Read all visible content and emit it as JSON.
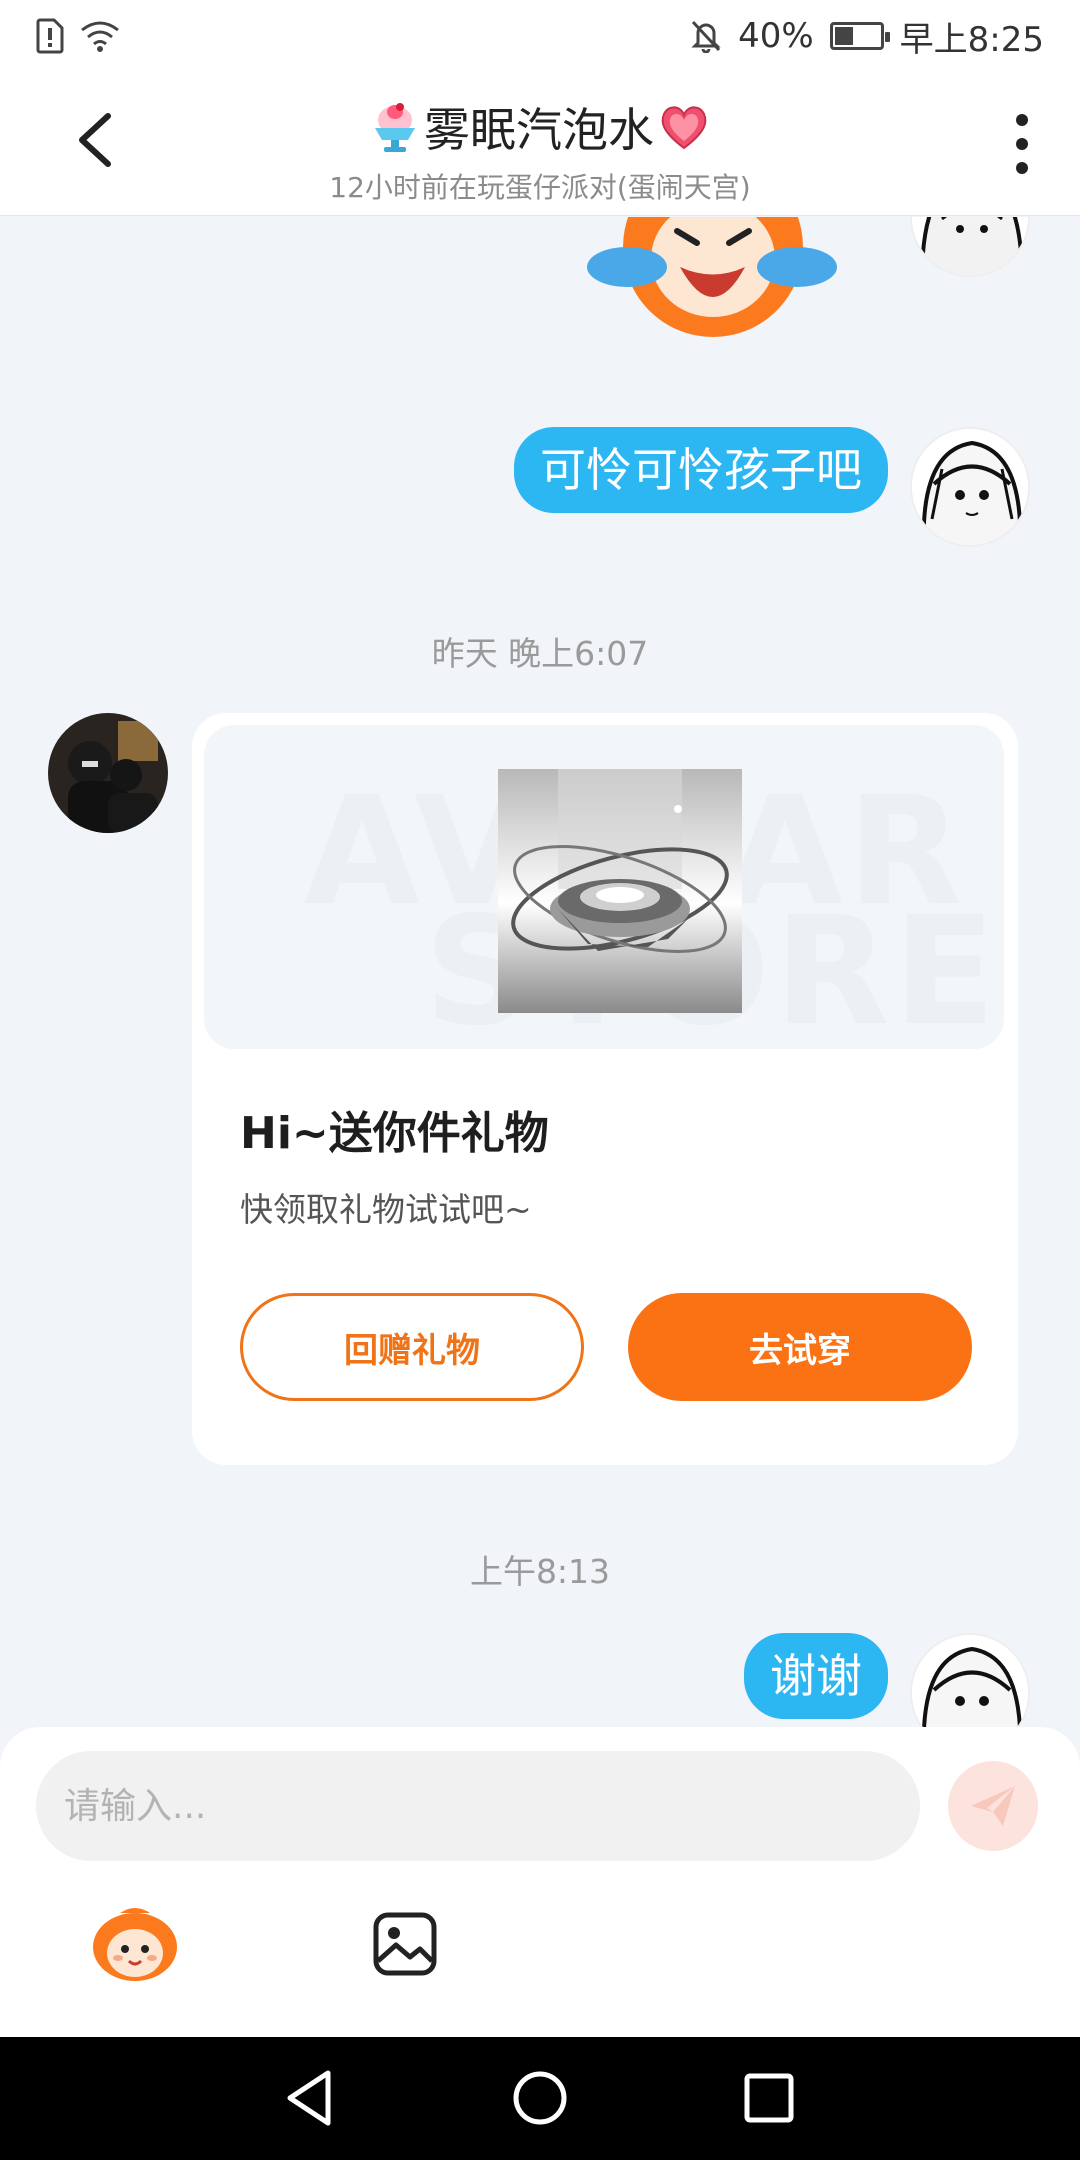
{
  "status": {
    "battery": "40%",
    "time": "早上8:25",
    "battery_level": 0.4
  },
  "header": {
    "title": "雾眠汽泡水",
    "subtitle": "12小时前在玩蛋仔派对(蛋闹天宫)"
  },
  "messages": {
    "m1": "可怜可怜孩子吧",
    "ts1": "昨天 晚上6:07",
    "card": {
      "watermark_line1": "AVATAR",
      "watermark_line2": "STORE",
      "title": "Hi~送你件礼物",
      "desc": "快领取礼物试试吧~",
      "btn_return": "回赠礼物",
      "btn_try": "去试穿"
    },
    "ts2": "上午8:13",
    "m2": "谢谢"
  },
  "input": {
    "placeholder": "请输入..."
  },
  "colors": {
    "accent": "#fb7214",
    "bubble": "#2cb6f2",
    "bg": "#f1f4f8"
  },
  "icons": [
    "back-icon",
    "more-icon",
    "shaved-ice-emoji",
    "heart-emoji",
    "send-icon",
    "mascot-icon",
    "image-icon",
    "nav-back-icon",
    "nav-home-icon",
    "nav-recents-icon"
  ]
}
